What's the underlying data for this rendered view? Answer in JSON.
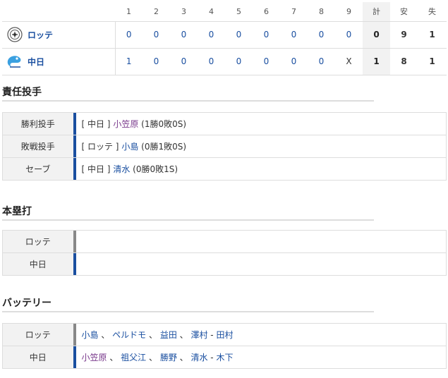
{
  "scoreboard": {
    "headers": [
      "1",
      "2",
      "3",
      "4",
      "5",
      "6",
      "7",
      "8",
      "9",
      "計",
      "安",
      "失"
    ],
    "teams": [
      {
        "name": "ロッテ",
        "innings": [
          "0",
          "0",
          "0",
          "0",
          "0",
          "0",
          "0",
          "0",
          "0"
        ],
        "runs": "0",
        "hits": "9",
        "errors": "1"
      },
      {
        "name": "中日",
        "innings": [
          "1",
          "0",
          "0",
          "0",
          "0",
          "0",
          "0",
          "0",
          "X"
        ],
        "runs": "1",
        "hits": "8",
        "errors": "1"
      }
    ]
  },
  "pitchers_section": {
    "title": "責任投手",
    "rows": [
      {
        "label": "勝利投手",
        "team": "[ 中日 ]",
        "name": "小笠原",
        "record": "(1勝0敗0S)"
      },
      {
        "label": "敗戦投手",
        "team": "[ ロッテ ]",
        "name": "小島",
        "record": "(0勝1敗0S)"
      },
      {
        "label": "セーブ",
        "team": "[ 中日 ]",
        "name": "清水",
        "record": "(0勝0敗1S)"
      }
    ]
  },
  "homerun_section": {
    "title": "本塁打",
    "rows": [
      {
        "label": "ロッテ",
        "value": ""
      },
      {
        "label": "中日",
        "value": ""
      }
    ]
  },
  "battery_section": {
    "title": "バッテリー",
    "rows": [
      {
        "label": "ロッテ",
        "pitchers": [
          "小島",
          "ペルドモ",
          "益田",
          "澤村"
        ],
        "catcher": "田村"
      },
      {
        "label": "中日",
        "pitchers": [
          "小笠原",
          "祖父江",
          "勝野",
          "清水"
        ],
        "catcher": "木下"
      }
    ]
  },
  "colors": {
    "accent_blue": "#1a4fa0",
    "lotte_bar": "#888888",
    "chunichi_bar": "#1a4fa0",
    "highlight_purple": "#7a3a8c"
  },
  "icons": {
    "lotte_logo": "lotte-logo-icon",
    "chunichi_logo": "chunichi-logo-icon"
  }
}
